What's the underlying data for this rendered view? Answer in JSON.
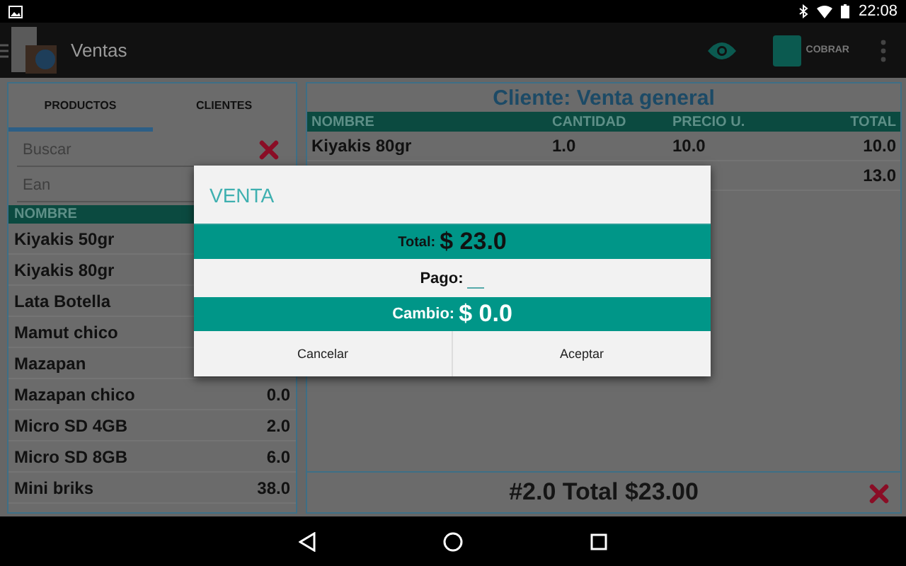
{
  "status_bar": {
    "time": "22:08"
  },
  "app_bar": {
    "title": "Ventas",
    "action": "COBRAR"
  },
  "tabs": [
    {
      "label": "PRODUCTOS",
      "selected": true
    },
    {
      "label": "CLIENTES",
      "selected": false
    }
  ],
  "search": {
    "placeholder": "Buscar"
  },
  "ean": {
    "placeholder": "Ean"
  },
  "products": {
    "columns": [
      "NOMBRE"
    ],
    "rows": [
      {
        "name": "Kiyakis 50gr"
      },
      {
        "name": "Kiyakis 80gr"
      },
      {
        "name": "Lata Botella"
      },
      {
        "name": "Mamut chico"
      },
      {
        "name": "Mazapan"
      },
      {
        "name": "Mazapan chico",
        "stock": "0.0"
      },
      {
        "name": "Micro SD 4GB",
        "stock": "2.0"
      },
      {
        "name": "Micro SD 8GB",
        "stock": "6.0"
      },
      {
        "name": "Mini briks",
        "stock": "38.0"
      }
    ]
  },
  "sale": {
    "client": "Cliente: Venta general",
    "columns": [
      "NOMBRE",
      "CANTIDAD",
      "PRECIO U.",
      "TOTAL"
    ],
    "rows": [
      {
        "name": "Kiyakis 80gr",
        "quantity": "1.0",
        "price": "10.0",
        "total": "10.0"
      },
      {
        "total": "13.0"
      }
    ],
    "footer": "#2.0 Total $23.00"
  },
  "dialog": {
    "title": "VENTA",
    "total_label": "Total:",
    "total": "$ 23.0",
    "payment_label": "Pago:",
    "change_label": "Cambio:",
    "change": "$ 0.0",
    "buttons": [
      "Cancelar",
      "Aceptar"
    ]
  }
}
